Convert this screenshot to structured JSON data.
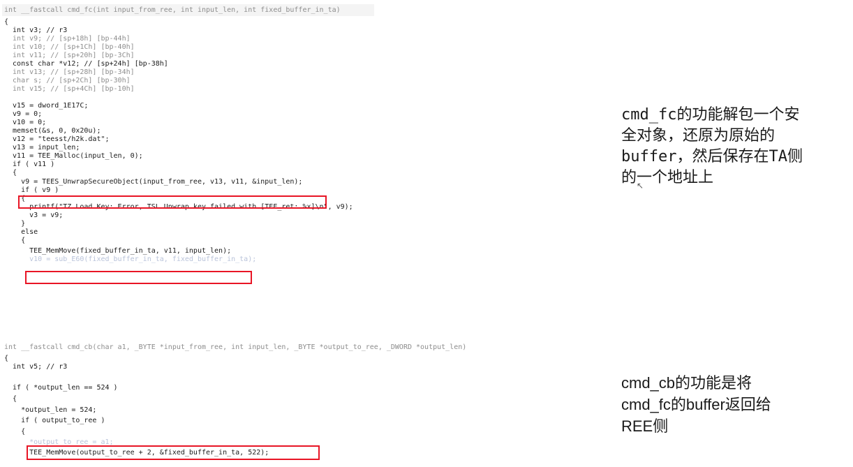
{
  "block1": {
    "lines": [
      {
        "text": "int __fastcall cmd_fc(int input_from_ree, int input_len, int fixed_buffer_in_ta)",
        "style": "gray"
      },
      {
        "text": "{",
        "style": "kw"
      },
      {
        "text": "  int v3; // r3",
        "style": "kw"
      },
      {
        "text": "  int v9; // [sp+18h] [bp-44h]",
        "style": "gray"
      },
      {
        "text": "  int v10; // [sp+1Ch] [bp-40h]",
        "style": "gray"
      },
      {
        "text": "  int v11; // [sp+20h] [bp-3Ch]",
        "style": "gray"
      },
      {
        "text": "  const char *v12; // [sp+24h] [bp-38h]",
        "style": "kw"
      },
      {
        "text": "  int v13; // [sp+28h] [bp-34h]",
        "style": "gray"
      },
      {
        "text": "  char s; // [sp+2Ch] [bp-30h]",
        "style": "gray"
      },
      {
        "text": "  int v15; // [sp+4Ch] [bp-10h]",
        "style": "gray"
      },
      {
        "text": "",
        "style": "kw"
      },
      {
        "text": "  v15 = dword_1E17C;",
        "style": "kw"
      },
      {
        "text": "  v9 = 0;",
        "style": "kw"
      },
      {
        "text": "  v10 = 0;",
        "style": "kw"
      },
      {
        "text": "  memset(&s, 0, 0x20u);",
        "style": "kw"
      },
      {
        "text": "  v12 = \"teesst/h2k.dat\";",
        "style": "kw"
      },
      {
        "text": "  v13 = input_len;",
        "style": "kw"
      },
      {
        "text": "  v11 = TEE_Malloc(input_len, 0);",
        "style": "kw"
      },
      {
        "text": "  if ( v11 )",
        "style": "kw"
      },
      {
        "text": "  {",
        "style": "kw"
      },
      {
        "text": "    v9 = TEES_UnwrapSecureObject(input_from_ree, v13, v11, &input_len);",
        "style": "kw"
      },
      {
        "text": "    if ( v9 )",
        "style": "kw"
      },
      {
        "text": "    {",
        "style": "kw"
      },
      {
        "text": "      printf(\"TZ Load Key: Error, TSL Unwrap key failed with [TEE_ret: %x]\\n\", v9);",
        "style": "kw"
      },
      {
        "text": "      v3 = v9;",
        "style": "kw"
      },
      {
        "text": "    }",
        "style": "kw"
      },
      {
        "text": "    else",
        "style": "kw"
      },
      {
        "text": "    {",
        "style": "kw"
      },
      {
        "text": "      TEE_MemMove(fixed_buffer_in_ta, v11, input_len);",
        "style": "kw"
      },
      {
        "text": "      v10 = sub_E60(fixed_buffer_in_ta, fixed_buffer_in_ta);",
        "style": "blur"
      }
    ]
  },
  "block2": {
    "lines": [
      {
        "text": "int __fastcall cmd_cb(char a1, _BYTE *input_from_ree, int input_len, _BYTE *output_to_ree, _DWORD *output_len)",
        "style": "gray"
      },
      {
        "text": "{",
        "style": "kw"
      },
      {
        "text": "  int v5; // r3",
        "style": "kw"
      },
      {
        "text": "",
        "style": "kw"
      },
      {
        "text": "  if ( *output_len == 524 )",
        "style": "kw"
      },
      {
        "text": "  {",
        "style": "kw"
      },
      {
        "text": "    *output_len = 524;",
        "style": "kw"
      },
      {
        "text": "    if ( output_to_ree )",
        "style": "kw"
      },
      {
        "text": "    {",
        "style": "kw"
      },
      {
        "text": "      *output_to_ree = a1;",
        "style": "blur"
      },
      {
        "text": "      TEE_MemMove(output_to_ree + 2, &fixed_buffer_in_ta, 522);",
        "style": "kw"
      }
    ]
  },
  "notes": {
    "note1_lines": [
      "cmd_fc的功能解包一个安",
      "全对象，还原为原始的",
      "buffer，然后保存在TA侧",
      "的一个地址上"
    ],
    "note2_lines": [
      "cmd_cb的功能是将",
      "cmd_fc的buffer返回给",
      "REE侧"
    ]
  },
  "colors": {
    "highlight_box": "#e81525",
    "comment": "#6f89c0",
    "variable": "#5d78b8"
  }
}
